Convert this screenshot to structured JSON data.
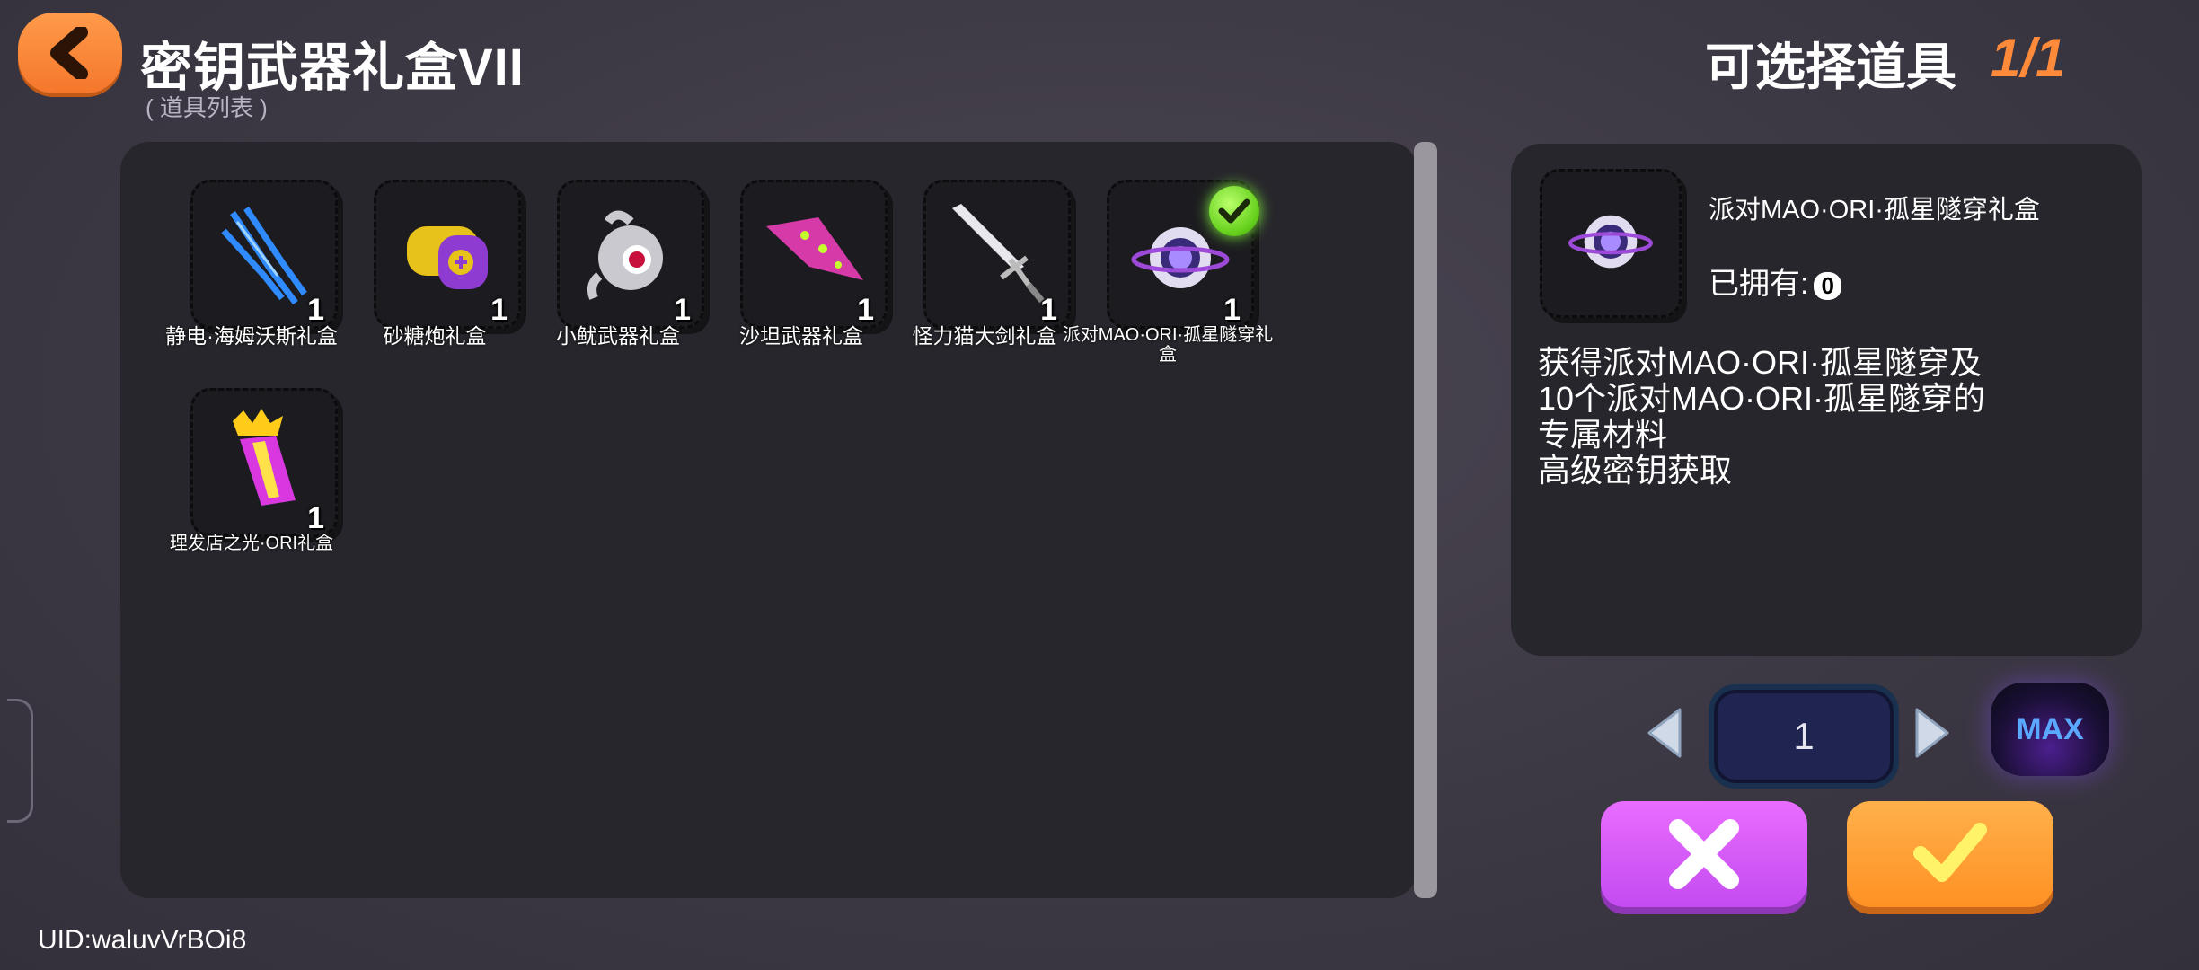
{
  "header": {
    "title": "密钥武器礼盒VII",
    "subtitle": "( 道具列表 )",
    "selectable_label": "可选择道具",
    "selectable_count": "1/1"
  },
  "items": [
    {
      "name": "静电·海姆沃斯礼盒",
      "qty": "1",
      "icon": "blue-lightning-claw-icon",
      "selected": false
    },
    {
      "name": "砂糖炮礼盒",
      "qty": "1",
      "icon": "candy-cannon-icon",
      "selected": false
    },
    {
      "name": "小鱿武器礼盒",
      "qty": "1",
      "icon": "squid-weapon-icon",
      "selected": false
    },
    {
      "name": "沙坦武器礼盒",
      "qty": "1",
      "icon": "pink-blade-icon",
      "selected": false
    },
    {
      "name": "怪力猫大剑礼盒",
      "qty": "1",
      "icon": "greatsword-icon",
      "selected": false
    },
    {
      "name": "派对MAO·ORI·孤星隧穿礼盒",
      "qty": "1",
      "icon": "planet-orb-icon",
      "selected": true
    },
    {
      "name": "理发店之光·ORI礼盒",
      "qty": "1",
      "icon": "crowned-crystal-icon",
      "selected": false
    }
  ],
  "detail": {
    "name": "派对MAO·ORI·孤星隧穿礼盒",
    "owned_label": "已拥有:",
    "owned_value": "0",
    "desc_line1": "获得派对MAO·ORI·孤星隧穿及",
    "desc_line2": "10个派对MAO·ORI·孤星隧穿的",
    "desc_line3": "专属材料",
    "desc_line4": "高级密钥获取"
  },
  "quantity": {
    "value": "1",
    "max_label": "MAX"
  },
  "footer": {
    "uid": "UID:waluvVrBOi8"
  },
  "colors": {
    "accent_orange": "#ff8a3a",
    "cancel_purple": "#d45cf6",
    "confirm_orange": "#ff9e30",
    "check_green": "#67d11e"
  }
}
